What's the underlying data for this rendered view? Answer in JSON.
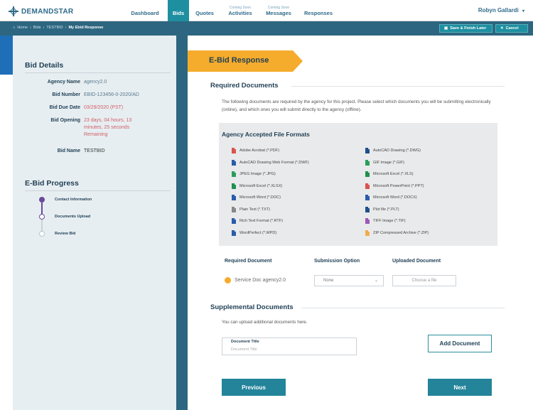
{
  "brand": {
    "name": "DEMANDSTAR"
  },
  "nav": {
    "items": [
      {
        "label": "Dashboard",
        "sup": ""
      },
      {
        "label": "Bids",
        "sup": ""
      },
      {
        "label": "Quotes",
        "sup": ""
      },
      {
        "label": "Activities",
        "sup": "Coming Soon"
      },
      {
        "label": "Messages",
        "sup": "Coming Soon"
      },
      {
        "label": "Responses",
        "sup": ""
      }
    ],
    "user": "Robyn Gallardi"
  },
  "breadcrumb": {
    "items": [
      "Home",
      "Bids",
      "TESTBID",
      "My Ebid Response"
    ]
  },
  "subbar": {
    "save_label": "Save & Finish Later",
    "cancel_label": "Cancel"
  },
  "bid_details": {
    "title": "Bid Details",
    "rows": [
      {
        "label": "Agency Name",
        "value": "agency2.0"
      },
      {
        "label": "Bid Number",
        "value": "EBID-123456-0-2020/AD"
      },
      {
        "label": "Bid Due Date",
        "value": "03/29/2020 (PST)"
      },
      {
        "label": "Bid Opening",
        "value": "23 days, 04 hours, 13 minutes, 25 seconds Remaining"
      },
      {
        "label": "Bid Name",
        "value": "TESTBID"
      }
    ]
  },
  "progress": {
    "title": "E-Bid Progress",
    "steps": [
      {
        "label": "Contact Information",
        "state": "done"
      },
      {
        "label": "Documents Upload",
        "state": "current"
      },
      {
        "label": "Review Bid",
        "state": "todo"
      }
    ]
  },
  "main": {
    "ribbon": "E-Bid Response",
    "required_title": "Required Documents",
    "required_intro": "The following documents are required by the agency for this project. Please select which documents you will be submitting electronically (online), and which ones you will submit directly to the agency (offline).",
    "formats_title": "Agency Accepted File Formats",
    "formats_left": [
      {
        "label": "Adobe Acrobat (*.PDF)",
        "color": "#d9534f"
      },
      {
        "label": "AutoCAD Drawing Web Format (*.DWF)",
        "color": "#2a5caa"
      },
      {
        "label": "JPEG Image (*.JPG)",
        "color": "#2a9d5c"
      },
      {
        "label": "Microsoft Excel (*.XLSX)",
        "color": "#1f8f4e"
      },
      {
        "label": "Microsoft Word (*.DOC)",
        "color": "#2a5caa"
      },
      {
        "label": "Plain Text (*.TXT)",
        "color": "#888888"
      },
      {
        "label": "Rich Text Format (*.RTF)",
        "color": "#2a5caa"
      },
      {
        "label": "WordPerfect (*.WPD)",
        "color": "#2a5caa"
      }
    ],
    "formats_right": [
      {
        "label": "AutoCAD Drawing (*.DWG)",
        "color": "#1f4f8a"
      },
      {
        "label": "GIF Image (*.GIF)",
        "color": "#2a9d5c"
      },
      {
        "label": "Microsoft Excel (*.XLS)",
        "color": "#1f8f4e"
      },
      {
        "label": "Microsoft PowerPoint (*.PPT)",
        "color": "#d9534f"
      },
      {
        "label": "Microsoft Word (*.DOCX)",
        "color": "#2a5caa"
      },
      {
        "label": "Plot file (*.PLT)",
        "color": "#1f4f8a"
      },
      {
        "label": "TIFF Image (*.TIF)",
        "color": "#9b59b6"
      },
      {
        "label": "ZIP Compressed Archive (*.ZIP)",
        "color": "#f0ad4e"
      }
    ],
    "table": {
      "col_required": "Required Document",
      "col_submission": "Submission Option",
      "col_uploaded": "Uploaded Document",
      "row_doc": "Service Doc agency2.0",
      "row_option": "None",
      "row_choose": "Choose a file"
    },
    "supp_title": "Supplemental Documents",
    "supp_intro": "You can upload additional documents here.",
    "doc_title_label": "Document Title",
    "doc_title_placeholder": "Document Title",
    "add_document": "Add Document",
    "previous": "Previous",
    "next": "Next"
  }
}
